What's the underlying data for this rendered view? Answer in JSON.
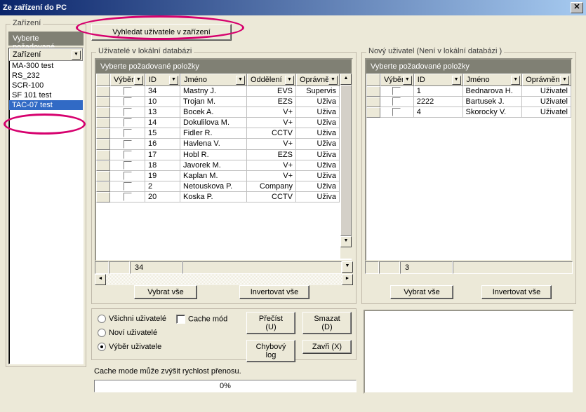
{
  "title": "Ze zařízení do PC",
  "devices_group": "Zařízení",
  "devices_prompt": "Vyberte požadované",
  "devices_header": "Zařízení",
  "devices": [
    "MA-300 test",
    "RS_232",
    "SCR-100",
    "SF 101 test",
    "TAC-07 test"
  ],
  "search_btn": "Vyhledat uživatele v zařízení",
  "local_group": "Uživatelé v lokální databázi",
  "local_prompt": "Vyberte požadované položky",
  "cols": {
    "vyber": "Výběr",
    "id": "ID",
    "jmeno": "Jméno",
    "oddeleni": "Oddělení",
    "opravneni": "Oprávnění"
  },
  "local_rows": [
    {
      "id": "34",
      "jmeno": "Mastny J.",
      "odd": "EVS",
      "opr": "Supervis"
    },
    {
      "id": "10",
      "jmeno": "Trojan M.",
      "odd": "EZS",
      "opr": "Uživa"
    },
    {
      "id": "13",
      "jmeno": "Bocek A.",
      "odd": "V+",
      "opr": "Uživa"
    },
    {
      "id": "14",
      "jmeno": "Dokulilova M.",
      "odd": "V+",
      "opr": "Uživa"
    },
    {
      "id": "15",
      "jmeno": "Fidler R.",
      "odd": "CCTV",
      "opr": "Uživa"
    },
    {
      "id": "16",
      "jmeno": "Havlena V.",
      "odd": "V+",
      "opr": "Uživa"
    },
    {
      "id": "17",
      "jmeno": "Hobl R.",
      "odd": "EZS",
      "opr": "Uživa"
    },
    {
      "id": "18",
      "jmeno": "Javorek M.",
      "odd": "V+",
      "opr": "Uživa"
    },
    {
      "id": "19",
      "jmeno": "Kaplan M.",
      "odd": "V+",
      "opr": "Uživa"
    },
    {
      "id": "2",
      "jmeno": "Netouskova P.",
      "odd": "Company",
      "opr": "Uživa"
    },
    {
      "id": "20",
      "jmeno": "Koska P.",
      "odd": "CCTV",
      "opr": "Uživa"
    }
  ],
  "local_count": "34",
  "new_group": "Nový uživatel (Není v lokální databázi )",
  "new_rows": [
    {
      "id": "1",
      "jmeno": "Bednarova H.",
      "opr": "Uživatel"
    },
    {
      "id": "2222",
      "jmeno": "Bartusek J.",
      "opr": "Uživatel"
    },
    {
      "id": "4",
      "jmeno": "Skorocky V.",
      "opr": "Uživatel"
    }
  ],
  "new_count": "3",
  "btn_select_all": "Vybrat vše",
  "btn_invert_all": "Invertovat vše",
  "radio_all": "Všichni uživatelé",
  "radio_new": "Noví uživatelé",
  "radio_sel": "Výběr uživatele",
  "chk_cache": "Cache mód",
  "btn_read": "Přečíst (U)",
  "btn_delete": "Smazat (D)",
  "btn_errlog": "Chybový log",
  "btn_close": "Zavři (X)",
  "cache_note": "Cache mode může zvýšit rychlost přenosu.",
  "progress": "0%"
}
